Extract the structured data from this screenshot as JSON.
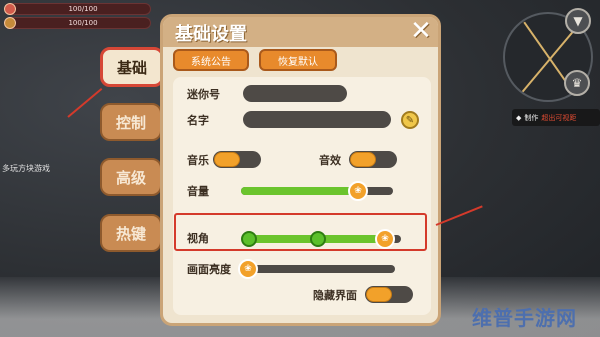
{
  "hud": {
    "health_text": "100/100",
    "food_text": "100/100"
  },
  "world_text": "多玩方块游戏",
  "panel": {
    "title": "基础设置",
    "close_label": "✕",
    "buttons": {
      "announce": "系统公告",
      "reset": "恢复默认"
    },
    "fields": {
      "mini_id_label": "迷你号",
      "name_label": "名字"
    },
    "settings": {
      "music_label": "音乐",
      "sfx_label": "音效",
      "volume_label": "音量",
      "fov_label": "视角",
      "quality_label": "画面亮度",
      "hide_ui_label": "隐藏界面"
    },
    "values": {
      "music_on": true,
      "sfx_on": true,
      "hide_ui_on": true,
      "volume_fraction": 0.77,
      "fov_fraction": 0.9,
      "brightness_fraction": 0.03
    }
  },
  "tabs": [
    {
      "label": "基础",
      "active": true
    },
    {
      "label": "控制",
      "active": false
    },
    {
      "label": "高级",
      "active": false
    },
    {
      "label": "热键",
      "active": false
    }
  ],
  "notice": {
    "prefix": "制作",
    "highlight": "超出可视距"
  },
  "watermark": "维普手游网",
  "colors": {
    "accent_orange": "#e88a2c",
    "slider_green": "#6bc42d",
    "highlight_red": "#d43a2b"
  }
}
